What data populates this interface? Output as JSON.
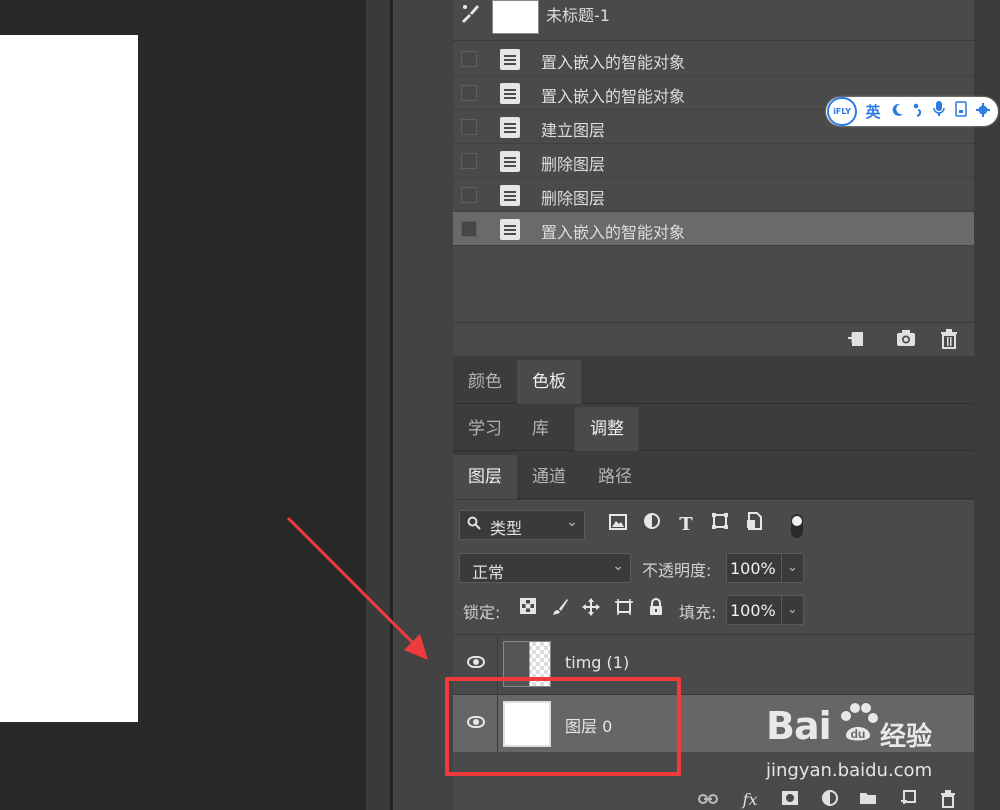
{
  "history": {
    "snapshot_name": "未标题-1",
    "items": [
      {
        "label": "置入嵌入的智能对象",
        "selected": false
      },
      {
        "label": "置入嵌入的智能对象",
        "selected": false
      },
      {
        "label": "建立图层",
        "selected": false
      },
      {
        "label": "删除图层",
        "selected": false
      },
      {
        "label": "删除图层",
        "selected": false
      },
      {
        "label": "置入嵌入的智能对象",
        "selected": true
      }
    ]
  },
  "tabs_color": [
    {
      "label": "颜色",
      "active": false
    },
    {
      "label": "色板",
      "active": true
    }
  ],
  "tabs_learn": [
    {
      "label": "学习",
      "active": false
    },
    {
      "label": "库",
      "active": false
    },
    {
      "label": "调整",
      "active": true
    }
  ],
  "tabs_layers": [
    {
      "label": "图层",
      "active": true
    },
    {
      "label": "通道",
      "active": false
    },
    {
      "label": "路径",
      "active": false
    }
  ],
  "layers_panel": {
    "filter_label": "类型",
    "blend_mode": "正常",
    "opacity_label": "不透明度:",
    "opacity_value": "100%",
    "lock_label": "锁定:",
    "fill_label": "填充:",
    "fill_value": "100%",
    "layers": [
      {
        "name": "timg (1)",
        "selected": false
      },
      {
        "name": "图层 0",
        "selected": true
      }
    ]
  },
  "ime": {
    "logo": "iFLY",
    "mode": "英"
  },
  "watermark": {
    "logo": "Bai",
    "cn": "经验",
    "url": "jingyan.baidu.com"
  },
  "colors": {
    "accent_red": "#ef3b3b",
    "ime_blue": "#2d7be0"
  }
}
